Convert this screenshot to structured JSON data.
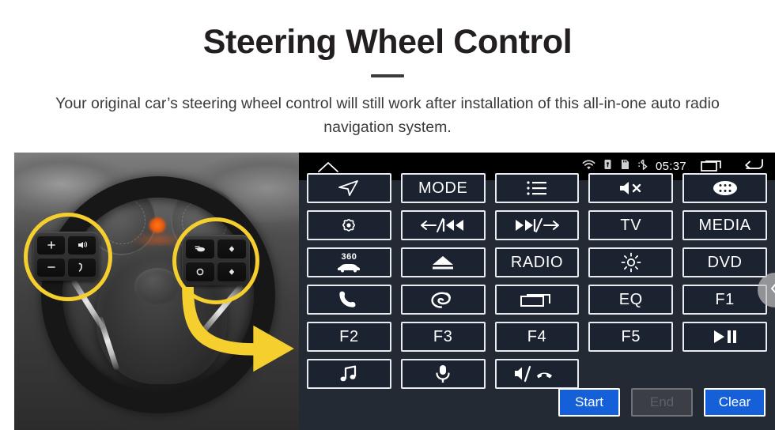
{
  "header": {
    "title": "Steering Wheel Control",
    "subtitle": "Your original car’s steering wheel control will still work after installation of this all-in-one auto radio navigation system."
  },
  "photo": {
    "alt": "Car steering wheel with two highlighted control button clusters and a yellow arrow pointing to the radio unit",
    "highlight_color": "#f5cf2e",
    "arrow_color": "#f5cf2e",
    "left_cluster_keys": [
      "volume-up",
      "voice-command",
      "volume-down",
      "phone-answer"
    ],
    "right_cluster_keys": [
      "source",
      "up",
      "mode",
      "down"
    ]
  },
  "unit": {
    "statusbar": {
      "home_icon": "home-icon",
      "icons": [
        "wifi-icon",
        "usb-lock-icon",
        "sd-card-icon",
        "bluetooth-icon"
      ],
      "time": "05:37",
      "recents_icon": "recents-icon",
      "back_icon": "back-icon"
    },
    "rows": [
      [
        {
          "name": "navigation",
          "icon": "navigation-arrow-icon",
          "label": ""
        },
        {
          "name": "mode",
          "icon": "",
          "label": "MODE"
        },
        {
          "name": "menu-list",
          "icon": "list-icon",
          "label": ""
        },
        {
          "name": "mute",
          "icon": "mute-icon",
          "label": ""
        },
        {
          "name": "apps",
          "icon": "apps-grid-icon",
          "label": ""
        }
      ],
      [
        {
          "name": "settings",
          "icon": "gear-icon",
          "label": ""
        },
        {
          "name": "previous",
          "icon": "previous-track-icon",
          "label": ""
        },
        {
          "name": "next",
          "icon": "next-track-icon",
          "label": ""
        },
        {
          "name": "tv",
          "icon": "",
          "label": "TV"
        },
        {
          "name": "media",
          "icon": "",
          "label": "MEDIA"
        }
      ],
      [
        {
          "name": "camera-360",
          "icon": "car-360-icon",
          "label": "360"
        },
        {
          "name": "eject",
          "icon": "eject-icon",
          "label": ""
        },
        {
          "name": "radio",
          "icon": "",
          "label": "RADIO"
        },
        {
          "name": "brightness",
          "icon": "brightness-icon",
          "label": ""
        },
        {
          "name": "dvd",
          "icon": "",
          "label": "DVD"
        }
      ],
      [
        {
          "name": "phone",
          "icon": "phone-icon",
          "label": ""
        },
        {
          "name": "voice-assistant",
          "icon": "swirl-icon",
          "label": ""
        },
        {
          "name": "recent-apps",
          "icon": "window-icon",
          "label": ""
        },
        {
          "name": "equalizer",
          "icon": "",
          "label": "EQ"
        },
        {
          "name": "f1",
          "icon": "",
          "label": "F1"
        }
      ],
      [
        {
          "name": "f2",
          "icon": "",
          "label": "F2"
        },
        {
          "name": "f3",
          "icon": "",
          "label": "F3"
        },
        {
          "name": "f4",
          "icon": "",
          "label": "F4"
        },
        {
          "name": "f5",
          "icon": "",
          "label": "F5"
        },
        {
          "name": "play-pause",
          "icon": "play-pause-icon",
          "label": ""
        }
      ],
      [
        {
          "name": "music",
          "icon": "music-note-icon",
          "label": ""
        },
        {
          "name": "microphone",
          "icon": "microphone-icon",
          "label": ""
        },
        {
          "name": "speaker-hangup",
          "icon": "speaker-hangup-icon",
          "label": ""
        }
      ]
    ],
    "actions": [
      {
        "name": "start",
        "label": "Start",
        "state": "enabled"
      },
      {
        "name": "end",
        "label": "End",
        "state": "disabled"
      },
      {
        "name": "clear",
        "label": "Clear",
        "state": "enabled"
      }
    ],
    "scroll_handle_icon": "chevron-left-icon",
    "colors": {
      "panel_bg": "#242a33",
      "button_bg": "#1b2230",
      "button_border": "#e8ebf0",
      "accent_blue": "#1560d8",
      "statusbar_bg": "#000000"
    }
  }
}
